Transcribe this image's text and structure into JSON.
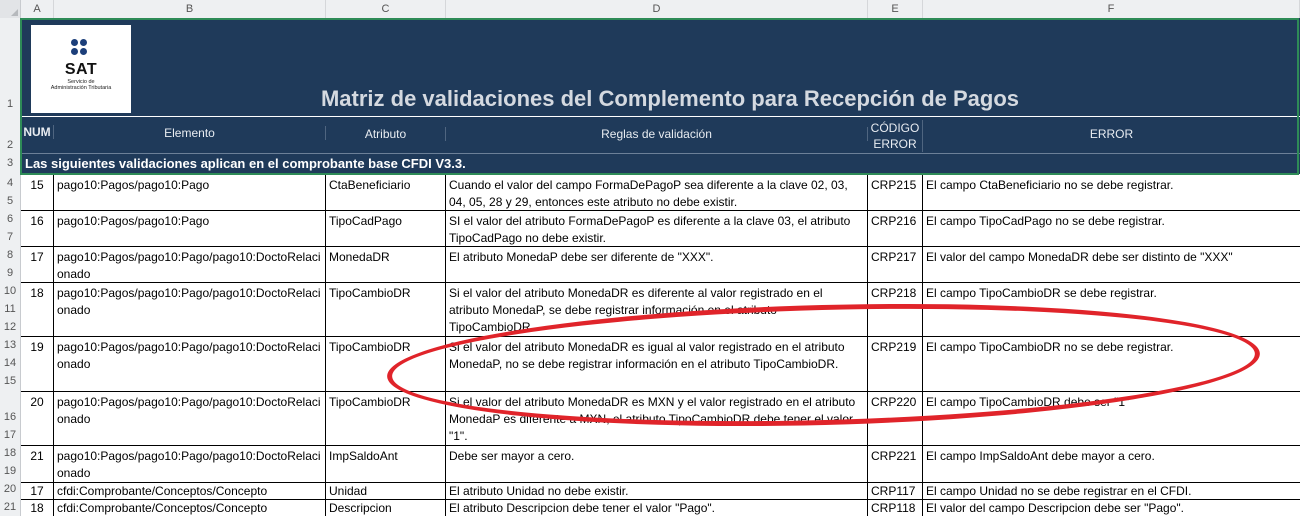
{
  "columns": [
    "A",
    "B",
    "C",
    "D",
    "E",
    "F"
  ],
  "row_numbers": [
    "1",
    "2",
    "3",
    "4",
    "5",
    "6",
    "7",
    "8",
    "9",
    "10",
    "11",
    "12",
    "13",
    "14",
    "15",
    "16",
    "17",
    "18",
    "19",
    "20",
    "21"
  ],
  "logo": {
    "word": "SAT",
    "sub1": "Servicio de",
    "sub2": "Administración Tributaria"
  },
  "title": "Matriz de validaciones del Complemento para Recepción de Pagos",
  "headers": {
    "num": "NUM",
    "elemento": "Elemento",
    "atributo": "Atributo",
    "reglas": "Reglas de validación",
    "codigo1": "CÓDIGO",
    "codigo2": "ERROR",
    "error": "ERROR"
  },
  "section_title": "Las siguientes validaciones aplican en el comprobante base CFDI V3.3.",
  "rows": [
    {
      "num": "15",
      "elemento": "pago10:Pagos/pago10:Pago",
      "atributo": "CtaBeneficiario",
      "regla": "Cuando el valor del campo FormaDePagoP sea diferente a la clave 02, 03, 04, 05, 28 y 29, entonces este atributo no debe existir.",
      "codigo": "CRP215",
      "error": "El campo CtaBeneficiario no se debe registrar."
    },
    {
      "num": "16",
      "elemento": "pago10:Pagos/pago10:Pago",
      "atributo": "TipoCadPago",
      "regla": "SI el valor del atributo FormaDePagoP es diferente a la clave 03, el atributo TipoCadPago no debe existir.",
      "codigo": "CRP216",
      "error": "El campo TipoCadPago no se debe registrar."
    },
    {
      "num": "17",
      "elemento": "pago10:Pagos/pago10:Pago/pago10:DoctoRelacionado",
      "atributo": "MonedaDR",
      "regla": "El atributo MonedaP debe ser diferente de \"XXX\".",
      "codigo": "CRP217",
      "error": "El valor del campo MonedaDR debe ser distinto de \"XXX\""
    },
    {
      "num": "18",
      "elemento": "pago10:Pagos/pago10:Pago/pago10:DoctoRelacionado",
      "atributo": "TipoCambioDR",
      "regla": "Si el valor del atributo MonedaDR es diferente al valor registrado en el atributo MonedaP, se debe registrar información en el atributo TipoCambioDR.",
      "codigo": "CRP218",
      "error": "El campo TipoCambioDR se debe registrar."
    },
    {
      "num": "19",
      "elemento": "pago10:Pagos/pago10:Pago/pago10:DoctoRelacionado",
      "atributo": "TipoCambioDR",
      "regla": "Si el valor del atributo MonedaDR es igual al valor registrado en el atributo MonedaP, no se debe registrar información en el atributo TipoCambioDR.",
      "codigo": "CRP219",
      "error": "El campo TipoCambioDR no se debe registrar."
    },
    {
      "num": "20",
      "elemento": "pago10:Pagos/pago10:Pago/pago10:DoctoRelacionado",
      "atributo": "TipoCambioDR",
      "regla": "Si el valor del atributo MonedaDR es MXN y el valor registrado en el atributo MonedaP es diferente a MXN, el atributo TipoCambioDR debe tener el valor \"1\".",
      "codigo": "CRP220",
      "error": "El campo TipoCambioDR debe ser \"1\""
    },
    {
      "num": "21",
      "elemento": "pago10:Pagos/pago10:Pago/pago10:DoctoRelacionado",
      "atributo": "ImpSaldoAnt",
      "regla": "Debe ser mayor a cero.",
      "codigo": "CRP221",
      "error": "El campo ImpSaldoAnt debe mayor a cero."
    },
    {
      "num": "17",
      "elemento": "cfdi:Comprobante/Conceptos/Concepto",
      "atributo": "Unidad",
      "regla": "El atributo Unidad no debe existir.",
      "codigo": "CRP117",
      "error": "El campo Unidad no se debe registrar en el CFDI."
    },
    {
      "num": "18",
      "elemento": "cfdi:Comprobante/Conceptos/Concepto",
      "atributo": "Descripcion",
      "regla": "El atributo Descripcion debe tener el valor \"Pago\".",
      "codigo": "CRP118",
      "error": "El valor del campo Descripcion debe ser \"Pago\"."
    }
  ]
}
